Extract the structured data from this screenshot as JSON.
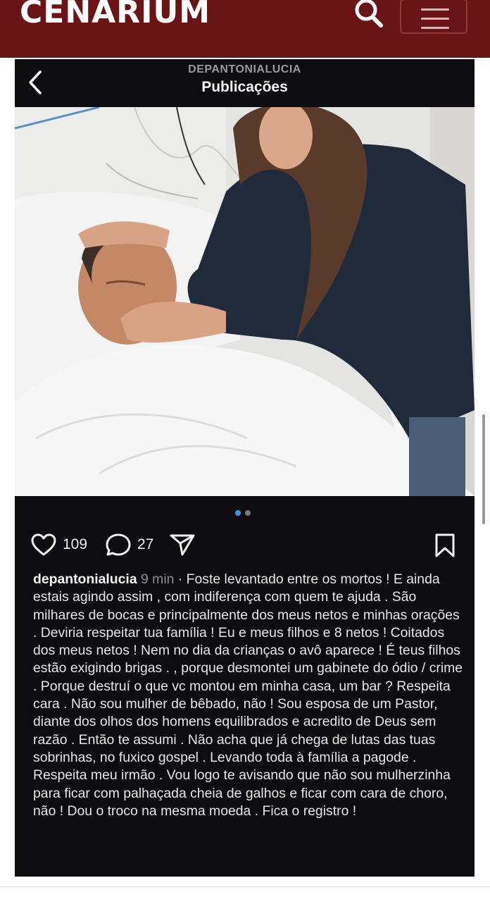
{
  "site": {
    "logo": "CENARIUM",
    "brand_color": "#6b1418"
  },
  "icons": {
    "search": "search-icon",
    "menu": "hamburger-icon",
    "back": "chevron-left-icon",
    "like": "heart-icon",
    "comment": "comment-icon",
    "share": "send-icon",
    "save": "bookmark-icon"
  },
  "instagram": {
    "username_header": "DEPANTONIALUCIA",
    "title": "Publicações",
    "carousel": {
      "total": 2,
      "active": 1,
      "active_color": "#3897f0"
    },
    "likes": "109",
    "comments": "27",
    "caption_user": "depantonialucia",
    "caption_time": "9 min",
    "caption_text": " · Foste levantado entre os mortos ! E ainda estais agindo assim , com indiferença com quem te ajuda . São milhares de bocas e principalmente dos meus netos e minhas orações .  Deviria respeitar tua família ! Eu e meus filhos e 8 netos ! Coitados dos meus netos ! Nem no dia da crianças  o avô aparece ! É teus filhos estão exigindo brigas . ,  porque desmontei um gabinete do ódio / crime . Porque destruí o que vc montou em  minha casa, um bar ? Respeita cara .  Não sou mulher  de bêbado,  não ! Sou esposa de um  Pastor,  diante dos olhos dos homens  equilibrados  e acredito de Deus sem razão . Então te assumi . Não acha que já chega de lutas das tuas sobrinhas, no fuxico gospel . Levando toda  à família  a pagode . Respeita meu irmão . Vou logo te avisando que não  sou mulherzinha para ficar com palhaçada cheia de galhos e ficar com  cara de choro,  não ! Dou o troco na mesma moeda . Fica o registro !"
  }
}
